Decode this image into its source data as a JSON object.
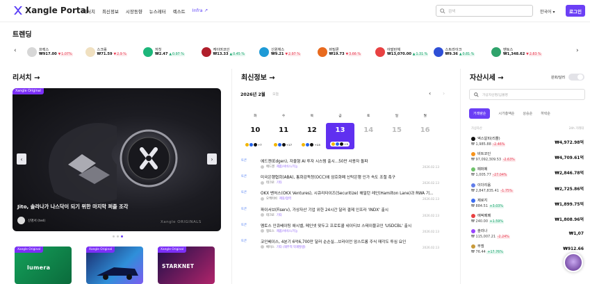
{
  "header": {
    "logo": "Xangle Portal",
    "nav": [
      "리서치",
      "최신정보",
      "시장동향",
      "뉴스레터",
      "렉스트"
    ],
    "nav_accent": "Infra",
    "search_placeholder": "검색",
    "language": "한국어",
    "login": "로그인"
  },
  "trending": {
    "title": "트렌딩",
    "items": [
      {
        "name": "프렉스",
        "price": "₩917.00",
        "change": "1.07%",
        "dir": "down",
        "color": "#d7d7d7",
        "icon": "coin-icon"
      },
      {
        "name": "스크롤",
        "price": "₩71.59",
        "change": "2.9 %",
        "dir": "down",
        "color": "#f0e0c0",
        "icon": "scroll-icon"
      },
      {
        "name": "저칫",
        "price": "₩2.47",
        "change": "0.97 %",
        "dir": "up",
        "color": "#1db67a",
        "icon": "leaf-icon"
      },
      {
        "name": "케이머코인",
        "price": "₩13.33",
        "change": "0.45 %",
        "dir": "up",
        "color": "#b01e2b",
        "icon": "coin-icon"
      },
      {
        "name": "신원체스",
        "price": "₩9.21",
        "change": "2.97 %",
        "dir": "down",
        "color": "#1e9ad6",
        "icon": "cube-icon"
      },
      {
        "name": "바빌론",
        "price": "₩19.73",
        "change": "3.66 %",
        "dir": "down",
        "color": "#e86a1e",
        "icon": "grid-icon"
      },
      {
        "name": "아발란체",
        "price": "₩13,070.00",
        "change": "1.31 %",
        "dir": "up",
        "color": "#e84142",
        "icon": "avax-icon"
      },
      {
        "name": "스트라이크",
        "price": "₩9.36",
        "change": "0.81 %",
        "dir": "up",
        "color": "#2e4fd6",
        "icon": "strike-icon"
      },
      {
        "name": "멘토스",
        "price": "₩1,348.62",
        "change": "2.83 %",
        "dir": "down",
        "color": "#2fa36b",
        "icon": "mantle-icon"
      }
    ]
  },
  "research": {
    "title": "리서치 →",
    "hero": {
      "badge": "Xangle Original",
      "title": "Jito, 솔라나가 나스닥이 되기 위한 마지막 퍼즐 조각",
      "author": "신명서 (ted)",
      "watermark": "Xangle ORIGINALS"
    },
    "cards": [
      {
        "badge": "Xangle Original",
        "word": "lumera"
      },
      {
        "badge": "Xangle Original",
        "word": ""
      },
      {
        "badge": "Xangle Original",
        "word": "STARKNET"
      }
    ]
  },
  "latest": {
    "title": "최신정보 →",
    "year_month": "2026년 2월",
    "today": "오늘",
    "weekdays": [
      "화",
      "수",
      "목",
      "금",
      "토",
      "일",
      "월"
    ],
    "days": [
      {
        "d": "10",
        "sel": false,
        "muted": false,
        "extra": "+7"
      },
      {
        "d": "11",
        "sel": false,
        "muted": false,
        "extra": "+17"
      },
      {
        "d": "12",
        "sel": false,
        "muted": false,
        "extra": "+13"
      },
      {
        "d": "13",
        "sel": true,
        "muted": false,
        "extra": "+9"
      },
      {
        "d": "14",
        "sel": false,
        "muted": true,
        "extra": ""
      },
      {
        "d": "15",
        "sel": false,
        "muted": true,
        "extra": ""
      },
      {
        "d": "16",
        "sel": false,
        "muted": true,
        "extra": ""
      }
    ],
    "news": [
      {
        "tag": "토큰",
        "title": "에드젠(Edgen), 자율형 AI 투자 시스템 출시...50만 사용자 돌파",
        "source": "에드젠",
        "category": "제품/서비스/기능",
        "date": "2026.02.13"
      },
      {
        "tag": "토큰",
        "title": "미국은행협회(ABA), 통화감독청(OCC)에 암호화폐 신탁은행 인가 속도 조절 촉구",
        "source": "테크로",
        "category": "기타",
        "date": "2026.02.13"
      },
      {
        "tag": "토큰",
        "title": "OKX 벤처스(OKX Ventures), 시큐리타이즈(Securitize) 해밀턴 레인(Hamilton Lane)과 RWA 기...",
        "source": "오케이비",
        "category": "제휴/협력",
        "date": "2026.02.13"
      },
      {
        "tag": "토큰",
        "title": "파이서브(Fiserv), 가상자산 기업 위한 24시간 달러 결제 인프라 'INDX' 출시",
        "source": "테크로",
        "category": "기타",
        "date": "2026.02.13"
      },
      {
        "tag": "토큰",
        "title": "멤토스 인큐베이팅 애시벨, 메인넷 맞두고 프로토콜 네이티브 스테이블코인 'USDCBL' 출시",
        "source": "멤토스",
        "category": "제품/서비스/기능",
        "date": "2026.02.13"
      },
      {
        "tag": "토큰",
        "title": "코인베이스, 4분기 6억6,700만 달러 순손실...브라이언 암스트롱 주식 매각도 투심 요인",
        "source": "베이스",
        "category": "기타 (재무적 악재발생)",
        "date": "2026.02.13"
      }
    ]
  },
  "assets": {
    "title": "자산시세 →",
    "toggle_label": "원화/달러",
    "search_placeholder": "가상자산명/심볼명",
    "tabs": [
      "거래량순",
      "시가총액순",
      "상승순",
      "하락순"
    ],
    "head_left": "가상자산",
    "head_right": "24h 거래대",
    "rows": [
      {
        "name": "엑스알피(리플)",
        "price": "₩ 1,985.88",
        "change": "-2.46%",
        "dir": "down",
        "value": "₩4,972.98억",
        "color": "#111"
      },
      {
        "name": "비트코인",
        "price": "₩ 97,092,309.53",
        "change": "-2.63%",
        "dir": "down",
        "value": "₩4,709.61억",
        "color": "#f7931a"
      },
      {
        "name": "페퍼페",
        "price": "₩ 1,005.77",
        "change": "-27.04%",
        "dir": "down",
        "value": "₩2,846.78억",
        "color": "#6fc26b"
      },
      {
        "name": "이더리움",
        "price": "₩ 2,847,835.41",
        "change": "-1.75%",
        "dir": "down",
        "value": "₩2,725.86억",
        "color": "#627eea"
      },
      {
        "name": "제로지",
        "price": "₩ 884.51",
        "change": "+3.03%",
        "dir": "up",
        "value": "₩1,899.75억",
        "color": "#3d6df0"
      },
      {
        "name": "에픽페페",
        "price": "₩ 240.00",
        "change": "+1.59%",
        "dir": "up",
        "value": "₩1,808.96억",
        "color": "#e84142"
      },
      {
        "name": "솔라나",
        "price": "₩ 115,007.21",
        "change": "-2.24%",
        "dir": "down",
        "value": "₩1,07",
        "color": "#9945ff"
      },
      {
        "name": "무엠",
        "price": "₩ 76.44",
        "change": "+17.76%",
        "dir": "up",
        "value": "₩912.66",
        "color": "#c89a3a"
      }
    ]
  }
}
